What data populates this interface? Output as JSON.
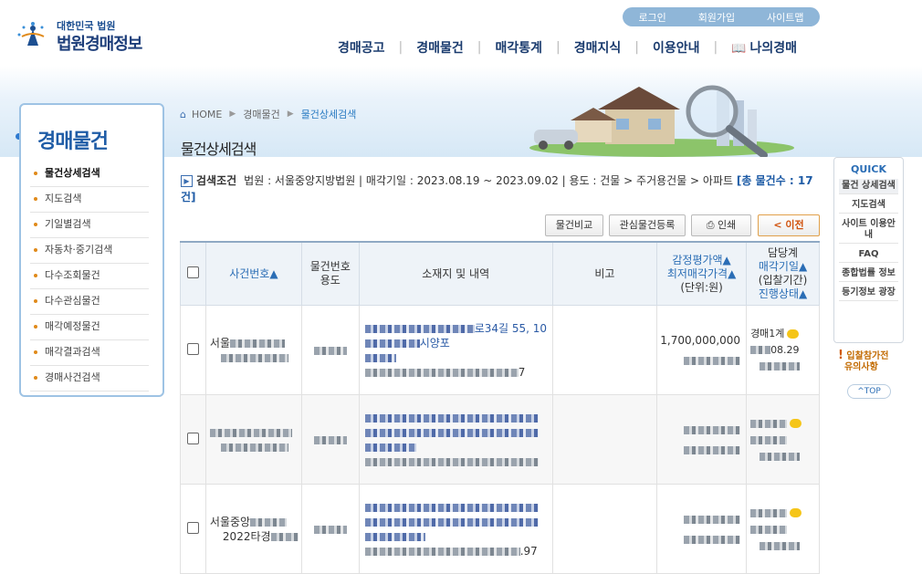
{
  "util": [
    "로그인",
    "회원가입",
    "사이트맵"
  ],
  "logo": {
    "small": "대한민국 법원",
    "big": "법원경매정보"
  },
  "gnb": [
    "경매공고",
    "경매물건",
    "매각통계",
    "경매지식",
    "이용안내",
    "나의경매"
  ],
  "lnb": {
    "title": "경매물건",
    "items": [
      "물건상세검색",
      "지도검색",
      "기일별검색",
      "자동차·중기검색",
      "다수조회물건",
      "다수관심물건",
      "매각예정물건",
      "매각결과검색",
      "경매사건검색"
    ]
  },
  "breadcrumb": [
    "HOME",
    "경매물건",
    "물건상세검색"
  ],
  "page_title": "물건상세검색",
  "cond": {
    "label": "검색조건",
    "text": "법원 : 서울중앙지방법원 | 매각기일 : 2023.08.19 ~ 2023.09.02 | 용도 : 건물 > 주거용건물 > 아파트",
    "count": "[총 물건수 : 17건]"
  },
  "buttons": {
    "compare": "물건비교",
    "fav": "관심물건등록",
    "print": "인쇄",
    "prev": "< 이전"
  },
  "headers": {
    "case": "사건번호▲",
    "item": [
      "물건번호",
      "용도"
    ],
    "addr": "소재지 및 내역",
    "note": "비고",
    "price": [
      "감정평가액▲",
      "최저매각가격▲",
      "(단위:원)"
    ],
    "dept": [
      "담당계",
      "매각기일▲",
      "(입찰기간)",
      "진행상태▲"
    ]
  },
  "rows": [
    {
      "case": "서울",
      "addr_fragment": "로34길 55, 10",
      "addr_fragment2": "시양포",
      "area": "7",
      "appraisal": "1,700,000,000",
      "dept": "경매1계",
      "date": "08.29"
    },
    {
      "case": "",
      "addr_fragment": "",
      "addr_fragment2": "",
      "area": "",
      "appraisal": "",
      "dept": "",
      "date": ""
    },
    {
      "case": "서울중앙",
      "case2": "2022타경",
      "addr_fragment": "",
      "addr_fragment2": "",
      "area": ".97",
      "appraisal": "",
      "dept": "",
      "date": ""
    }
  ],
  "quick": {
    "title": "QUICK",
    "items": [
      "물건 상세검색",
      "지도검색",
      "사이트 이용안내",
      "FAQ",
      "종합법률 정보",
      "등기정보 광장"
    ]
  },
  "warn": [
    "입찰참가전",
    "유의사항"
  ],
  "top": "^TOP"
}
